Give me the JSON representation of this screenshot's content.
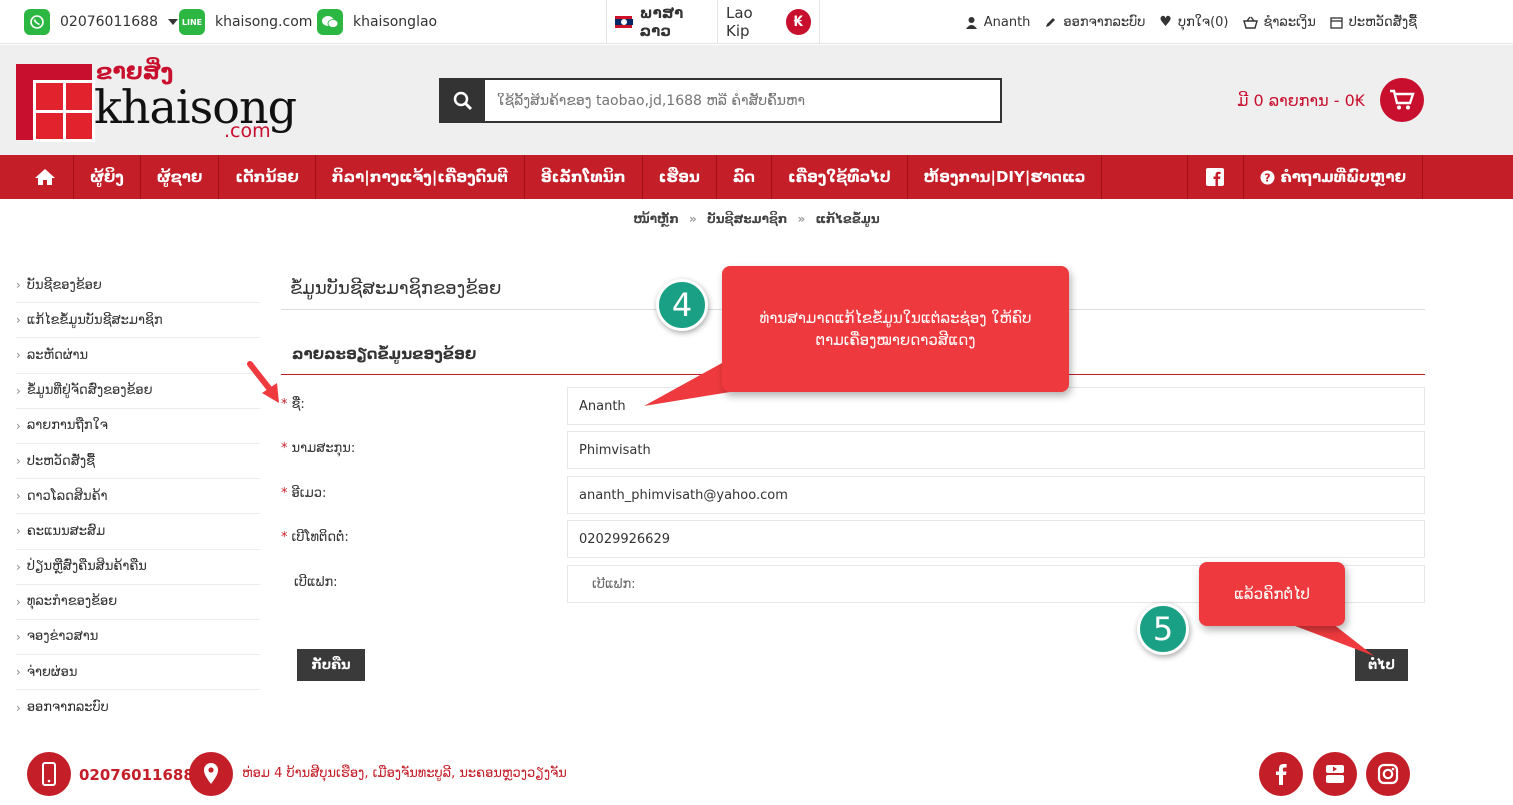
{
  "topbar": {
    "whatsapp": "02076011688",
    "line": "khaisong.com",
    "wechat": "khaisonglao",
    "language": "ພາສາລາວ",
    "currency": "Lao Kip",
    "currency_symbol": "₭",
    "user": "Ananth",
    "logout": "ອອກຈາກລະບົບ",
    "wishlist": "ບຸກໃຈ(0)",
    "checkout": "ຊໍາລະເງິນ",
    "order_history": "ປະຫວັດສັ່ງຊື້"
  },
  "header": {
    "logo_lao": "ຂາຍສິ່ງ",
    "logo_main": "khaisong",
    "logo_com": ".com",
    "search_placeholder": "ໃຊ້ລິ້ງສິນຄ້າຂອງ taobao,jd,1688 ຫລື ຄໍາສັບຄົ້ນຫາ",
    "cart_text": "ມີ 0 ລາຍການ - 0₭"
  },
  "nav": {
    "items": [
      "ຜູ້ຍິງ",
      "ຜູ້ຊາຍ",
      "ເດັກນ້ອຍ",
      "ກິລາ|ກາງແຈ້ງ|ເຄື່ອງດົນຕີ",
      "ອີເລັກໂທນິກ",
      "ເຮືອນ",
      "ລົດ",
      "ເຄື່ອງໃຊ້ທົ່ວໄປ",
      "ຫ້ອງການ|DIY|ຮາດແວ"
    ],
    "help": "ຄໍາຖາມທີ່ພົບຫຼາຍ"
  },
  "breadcrumb": [
    "ໜ້າຫຼັກ",
    "ບັນຊີສະມາຊິກ",
    "ແກ້ໄຂຂໍ້ມູນ"
  ],
  "sidebar": {
    "items": [
      "ບັນຊີຂອງຂ້ອຍ",
      "ແກ້ໄຂຂໍ້ມູນບັນຊີສະມາຊິກ",
      "ລະຫັດຜ່ານ",
      "ຂໍ້ມູນທີ່ຢູ່ຈັດສົ່ງຂອງຂ້ອຍ",
      "ລາຍການຖືກໃຈ",
      "ປະຫວັດສັ່ງຊື້",
      "ດາວໂລດສິນຄ້າ",
      "ຄະແນນສະສົມ",
      "ປ່ຽນຫຼືສົ່ງຄືນສິນຄ້າຄືນ",
      "ທຸລະກໍາຂອງຂ້ອຍ",
      "ຈອງຂ່າວສານ",
      "ຈ່າຍຜ່ອນ",
      "ອອກຈາກລະບົບ"
    ]
  },
  "main": {
    "page_title": "ຂໍ້ມູນບັນຊີສະມາຊິກຂອງຂ້ອຍ",
    "section_title": "ລາຍລະອຽດຂໍ້ມູນຂອງຂ້ອຍ",
    "fields": {
      "first_name": {
        "label": "ຊື່:",
        "value": "Ananth",
        "required": "*"
      },
      "last_name": {
        "label": "ນາມສະກຸນ:",
        "value": "Phimvisath",
        "required": "*"
      },
      "email": {
        "label": "ອີເມວ:",
        "value": "ananth_phimvisath@yahoo.com",
        "required": "*"
      },
      "phone": {
        "label": "ເບີໂທຕິດຕໍ່:",
        "value": "02029926629",
        "required": "*"
      },
      "fax": {
        "label": "ເບີແຟກ:",
        "placeholder": "ເບີແຟກ:"
      }
    },
    "back_button": "ກັບຄືນ",
    "continue_button": "ຕໍ່ໄປ"
  },
  "annotations": {
    "step4_number": "4",
    "step4_text": "ທ່ານສາມາດແກ້ໄຂຂໍ້ມູນໃນແຕ່ລະຊ່ອງ ໃຫ້ຄົບຕາມເຄື່ອງໝາຍດາວສີແດງ",
    "step5_number": "5",
    "step5_text": "ແລ້ວຄິກຕໍ່ໄປ",
    "callout_color": "#ee3a3e",
    "badge_color": "#1aa085"
  },
  "footer": {
    "phone": "02076011688",
    "address": "ຫ່ອມ 4 ບ້ານສີບຸນເຮືອງ, ເມືອງຈັນທະບູລີ, ນະຄອນຫຼວງວຽງຈັນ"
  },
  "colors": {
    "brand_red": "#c41e28",
    "dark": "#333333"
  }
}
